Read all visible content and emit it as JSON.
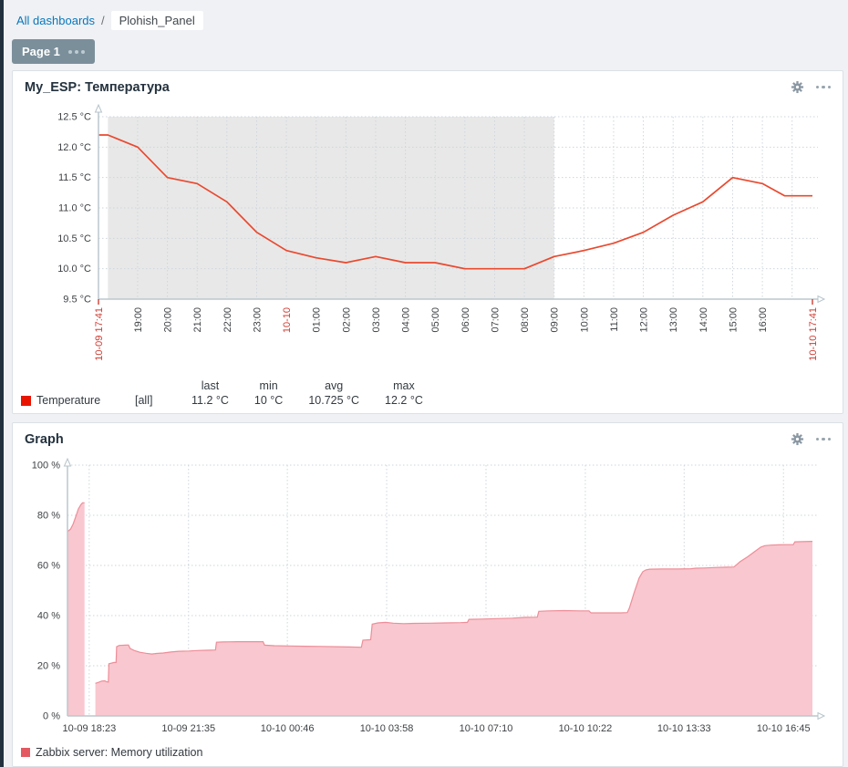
{
  "breadcrumb": {
    "all_dashboards": "All dashboards",
    "separator": "/",
    "current": "Plohish_Panel"
  },
  "page_tab": {
    "label": "Page 1"
  },
  "panel1": {
    "title": "My_ESP: Температура"
  },
  "panel2": {
    "title": "Graph"
  },
  "colors": {
    "accent_link": "#0977bb",
    "tab_bg": "#7b8f9b",
    "temp_line": "#e9492f",
    "temp_legend_swatch": "#e91400",
    "non_working_band": "#e8e8e8",
    "mem_area_fill": "#f9c7cf",
    "mem_area_line": "#ee8d98",
    "mem_legend_swatch": "#e45961",
    "red_tick_label": "#cf3d33"
  },
  "chart_data": [
    {
      "type": "line",
      "title": "My_ESP: Температура",
      "unit": "°C",
      "time_window": {
        "start_label": "10-09 17:41",
        "end_label": "10-10 17:41",
        "minutes": 1440
      },
      "ylim": [
        9.5,
        12.5
      ],
      "grid": true,
      "legend_position": "bottom",
      "non_working_band_t": [
        19,
        919
      ],
      "y_ticks": [
        {
          "v": 12.5,
          "label": "12.5 °C"
        },
        {
          "v": 12.0,
          "label": "12.0 °C"
        },
        {
          "v": 11.5,
          "label": "11.5 °C"
        },
        {
          "v": 11.0,
          "label": "11.0 °C"
        },
        {
          "v": 10.5,
          "label": "10.5 °C"
        },
        {
          "v": 10.0,
          "label": "10.0 °C"
        },
        {
          "v": 9.5,
          "label": "9.5 °C"
        }
      ],
      "x_ticks": [
        {
          "t": 0,
          "label": "10-09 17:41",
          "accent": true
        },
        {
          "t": 79,
          "label": "19:00"
        },
        {
          "t": 139,
          "label": "20:00"
        },
        {
          "t": 199,
          "label": "21:00"
        },
        {
          "t": 259,
          "label": "22:00"
        },
        {
          "t": 319,
          "label": "23:00"
        },
        {
          "t": 379,
          "label": "10-10",
          "accent": true
        },
        {
          "t": 439,
          "label": "01:00"
        },
        {
          "t": 499,
          "label": "02:00"
        },
        {
          "t": 559,
          "label": "03:00"
        },
        {
          "t": 619,
          "label": "04:00"
        },
        {
          "t": 679,
          "label": "05:00"
        },
        {
          "t": 739,
          "label": "06:00"
        },
        {
          "t": 799,
          "label": "07:00"
        },
        {
          "t": 859,
          "label": "08:00"
        },
        {
          "t": 919,
          "label": "09:00"
        },
        {
          "t": 979,
          "label": "10:00"
        },
        {
          "t": 1039,
          "label": "11:00"
        },
        {
          "t": 1099,
          "label": "12:00"
        },
        {
          "t": 1159,
          "label": "13:00"
        },
        {
          "t": 1219,
          "label": "14:00"
        },
        {
          "t": 1279,
          "label": "15:00"
        },
        {
          "t": 1339,
          "label": "16:00"
        },
        {
          "t": 1440,
          "label": "10-10 17:41",
          "accent": true
        }
      ],
      "series": [
        {
          "name": "Temperature",
          "points": [
            [
              0,
              12.2
            ],
            [
              19,
              12.2
            ],
            [
              79,
              12.0
            ],
            [
              139,
              11.5
            ],
            [
              199,
              11.4
            ],
            [
              259,
              11.1
            ],
            [
              319,
              10.6
            ],
            [
              379,
              10.3
            ],
            [
              439,
              10.18
            ],
            [
              499,
              10.1
            ],
            [
              559,
              10.2
            ],
            [
              619,
              10.1
            ],
            [
              679,
              10.1
            ],
            [
              739,
              10.0
            ],
            [
              799,
              10.0
            ],
            [
              859,
              10.0
            ],
            [
              919,
              10.2
            ],
            [
              979,
              10.3
            ],
            [
              1039,
              10.42
            ],
            [
              1099,
              10.6
            ],
            [
              1159,
              10.88
            ],
            [
              1219,
              11.1
            ],
            [
              1279,
              11.5
            ],
            [
              1339,
              11.4
            ],
            [
              1384,
              11.2
            ],
            [
              1440,
              11.2
            ]
          ]
        }
      ],
      "legend": {
        "name": "Temperature",
        "scope": "[all]",
        "stats": [
          {
            "label": "last",
            "value": "11.2 °C"
          },
          {
            "label": "min",
            "value": "10 °C"
          },
          {
            "label": "avg",
            "value": "10.725 °C"
          },
          {
            "label": "max",
            "value": "12.2 °C"
          }
        ]
      }
    },
    {
      "type": "area",
      "title": "Graph",
      "unit": "%",
      "time_window": {
        "start_label": "10-09 17:41",
        "end_label": "10-10 17:41",
        "minutes": 1440
      },
      "ylim": [
        0,
        100
      ],
      "grid": true,
      "legend_position": "bottom",
      "y_ticks": [
        {
          "v": 100,
          "label": "100 %"
        },
        {
          "v": 80,
          "label": "80 %"
        },
        {
          "v": 60,
          "label": "60 %"
        },
        {
          "v": 40,
          "label": "40 %"
        },
        {
          "v": 20,
          "label": "20 %"
        },
        {
          "v": 0,
          "label": "0 %"
        }
      ],
      "x_ticks": [
        {
          "t": 42,
          "label": "10-09 18:23"
        },
        {
          "t": 234,
          "label": "10-09 21:35"
        },
        {
          "t": 425,
          "label": "10-10 00:46"
        },
        {
          "t": 617,
          "label": "10-10 03:58"
        },
        {
          "t": 809,
          "label": "10-10 07:10"
        },
        {
          "t": 1001,
          "label": "10-10 10:22"
        },
        {
          "t": 1192,
          "label": "10-10 13:33"
        },
        {
          "t": 1384,
          "label": "10-10 16:45"
        }
      ],
      "series": [
        {
          "name": "Zabbix server: Memory utilization",
          "segments": [
            [
              [
                0,
                73.5
              ],
              [
                6,
                74.5
              ],
              [
                11,
                76.5
              ],
              [
                16,
                79.5
              ],
              [
                21,
                82.5
              ],
              [
                26,
                84.3
              ],
              [
                29,
                85
              ],
              [
                33,
                85
              ]
            ],
            [
              [
                54,
                13
              ],
              [
                60,
                13.4
              ],
              [
                66,
                13.9
              ],
              [
                72,
                14
              ],
              [
                76,
                13.6
              ],
              [
                79,
                13.5
              ],
              [
                80,
                20.8
              ],
              [
                90,
                21.3
              ],
              [
                94,
                21.3
              ],
              [
                95,
                27.6
              ],
              [
                100,
                28.1
              ],
              [
                112,
                28.2
              ],
              [
                118,
                28.3
              ],
              [
                121,
                26.9
              ],
              [
                130,
                26
              ],
              [
                140,
                25.4
              ],
              [
                152,
                25
              ],
              [
                163,
                24.7
              ],
              [
                172,
                24.9
              ],
              [
                185,
                25.1
              ],
              [
                200,
                25.5
              ],
              [
                215,
                25.8
              ],
              [
                235,
                25.9
              ],
              [
                255,
                26.1
              ],
              [
                275,
                26.2
              ],
              [
                286,
                26.3
              ],
              [
                288,
                29.4
              ],
              [
                300,
                29.5
              ],
              [
                330,
                29.6
              ],
              [
                378,
                29.6
              ],
              [
                381,
                28.2
              ],
              [
                400,
                28
              ],
              [
                430,
                27.9
              ],
              [
                460,
                27.8
              ],
              [
                490,
                27.7
              ],
              [
                520,
                27.6
              ],
              [
                545,
                27.5
              ],
              [
                568,
                27.4
              ],
              [
                571,
                30.2
              ],
              [
                586,
                30.4
              ],
              [
                589,
                36.6
              ],
              [
                600,
                37.1
              ],
              [
                615,
                37.3
              ],
              [
                630,
                37
              ],
              [
                650,
                36.8
              ],
              [
                670,
                36.9
              ],
              [
                700,
                37
              ],
              [
                730,
                37.1
              ],
              [
                760,
                37.2
              ],
              [
                773,
                37.3
              ],
              [
                776,
                38.5
              ],
              [
                800,
                38.6
              ],
              [
                830,
                38.8
              ],
              [
                860,
                39
              ],
              [
                885,
                39.3
              ],
              [
                908,
                39.4
              ],
              [
                911,
                41.7
              ],
              [
                930,
                41.9
              ],
              [
                960,
                42
              ],
              [
                990,
                41.9
              ],
              [
                1008,
                41.9
              ],
              [
                1012,
                41.1
              ],
              [
                1040,
                41.1
              ],
              [
                1070,
                41.1
              ],
              [
                1082,
                41.2
              ],
              [
                1086,
                43
              ],
              [
                1095,
                49
              ],
              [
                1105,
                55
              ],
              [
                1112,
                57.5
              ],
              [
                1118,
                58.2
              ],
              [
                1125,
                58.5
              ],
              [
                1150,
                58.6
              ],
              [
                1180,
                58.6
              ],
              [
                1205,
                58.7
              ],
              [
                1215,
                58.9
              ],
              [
                1230,
                59
              ],
              [
                1255,
                59.2
              ],
              [
                1275,
                59.3
              ],
              [
                1288,
                59.4
              ],
              [
                1291,
                59.9
              ],
              [
                1300,
                61.5
              ],
              [
                1315,
                63.5
              ],
              [
                1328,
                65.5
              ],
              [
                1340,
                67.3
              ],
              [
                1348,
                67.9
              ],
              [
                1360,
                68.1
              ],
              [
                1375,
                68.2
              ],
              [
                1390,
                68.3
              ],
              [
                1403,
                68.3
              ],
              [
                1406,
                69.4
              ],
              [
                1420,
                69.5
              ],
              [
                1440,
                69.6
              ]
            ]
          ]
        }
      ],
      "legend": {
        "name": "Zabbix server: Memory utilization"
      }
    }
  ]
}
